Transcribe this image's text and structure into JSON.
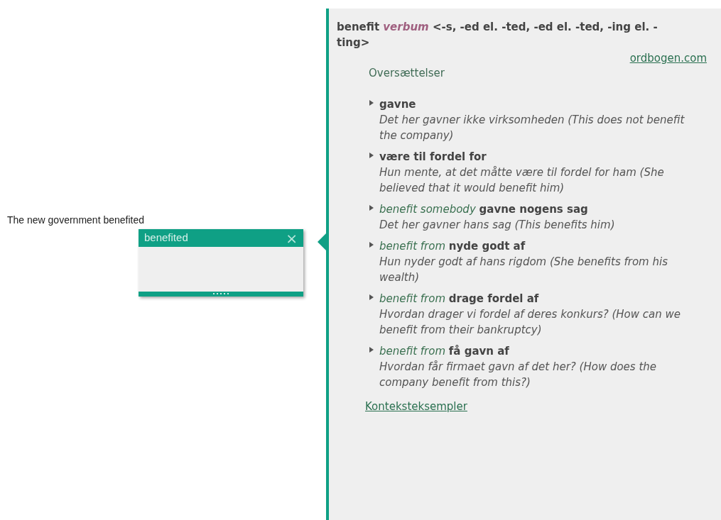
{
  "sentence": "The new government benefited",
  "popup": {
    "word": "benefited",
    "close": "×"
  },
  "entry": {
    "headword": "benefit",
    "part_of_speech": "verbum",
    "inflection": "<-s, -ed el. -ted, -ed el. -ted, -ing el. -ting>",
    "source": "ordbogen.com",
    "section": "Oversættelser",
    "translations": [
      {
        "translation": "gavne",
        "example": "Det her gavner ikke virksomheden (This does not benefit the company)"
      },
      {
        "translation": "være til fordel for",
        "example": "Hun mente, at det måtte være til fordel for ham (She believed that it would benefit him)"
      },
      {
        "phrase": "benefit somebody",
        "translation": "gavne nogens sag",
        "example": "Det her gavner hans sag (This benefits him)"
      },
      {
        "phrase": "benefit from",
        "translation": "nyde godt af",
        "example": "Hun nyder godt af hans rigdom (She benefits from his wealth)"
      },
      {
        "phrase": "benefit from",
        "translation": "drage fordel af",
        "example": "Hvordan drager vi fordel af deres konkurs? (How can we benefit from their bankruptcy)"
      },
      {
        "phrase": "benefit from",
        "translation": "få gavn af",
        "example": "Hvordan får firmaet gavn af det her? (How does the company benefit from this?)"
      }
    ],
    "more_link": "Konteksteksempler"
  }
}
